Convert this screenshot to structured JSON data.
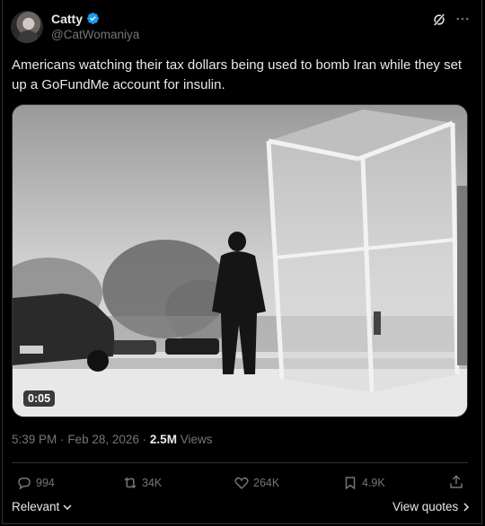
{
  "author": {
    "display_name": "Catty",
    "handle": "@CatWomaniya",
    "verified": true
  },
  "tweet": {
    "text": "Americans watching their tax dollars being used to bomb Iran while they set up a GoFundMe account for insulin."
  },
  "media": {
    "type": "video",
    "duration": "0:05",
    "description_icon": "black-and-white-video-still"
  },
  "meta": {
    "time": "5:39 PM",
    "separator": "·",
    "date": "Feb 28, 2026",
    "views_count": "2.5M",
    "views_label": "Views"
  },
  "actions": {
    "replies": "994",
    "reposts": "34K",
    "likes": "264K",
    "bookmarks": "4.9K"
  },
  "footer": {
    "sort_label": "Relevant",
    "view_quotes_label": "View quotes"
  },
  "colors": {
    "background": "#000000",
    "primary_text": "#e7e9ea",
    "secondary_text": "#71767b",
    "verified_blue": "#1d9bf0",
    "border": "#2f3336"
  }
}
